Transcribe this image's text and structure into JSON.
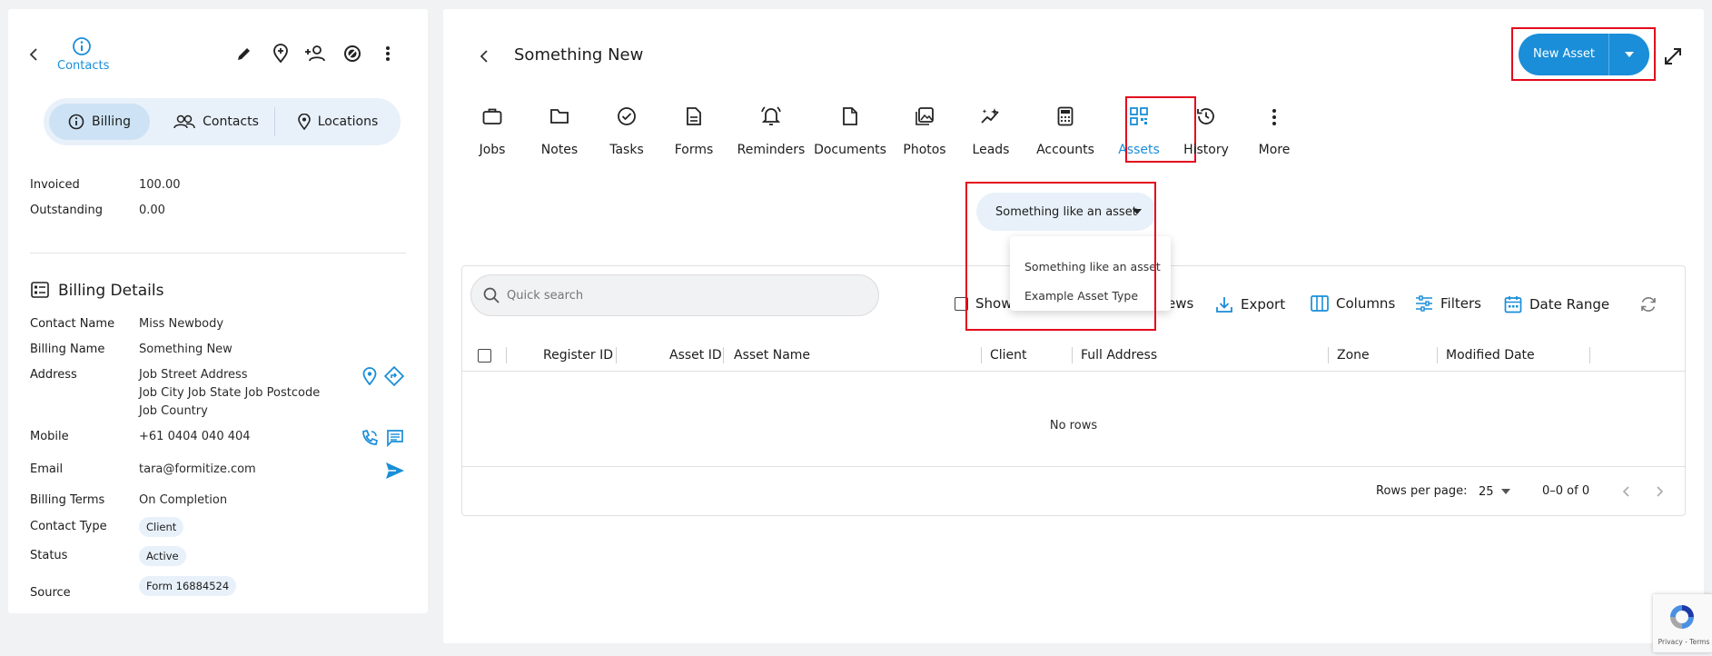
{
  "left": {
    "header": {
      "contacts_label": "Contacts"
    },
    "segments": [
      {
        "label": "Billing",
        "icon": "info-icon"
      },
      {
        "label": "Contacts",
        "icon": "people-icon"
      },
      {
        "label": "Locations",
        "icon": "pin-icon"
      }
    ],
    "totals": [
      {
        "label": "Invoiced",
        "value": "100.00"
      },
      {
        "label": "Outstanding",
        "value": "0.00"
      }
    ],
    "billing_details": {
      "title": "Billing Details",
      "contact_name_label": "Contact Name",
      "contact_name": "Miss Newbody",
      "billing_name_label": "Billing Name",
      "billing_name": "Something New",
      "address_label": "Address",
      "address_line1": "Job Street Address",
      "address_line2": "Job City Job State Job Postcode",
      "address_line3": "Job Country",
      "mobile_label": "Mobile",
      "mobile": "+61 0404 040 404",
      "email_label": "Email",
      "email": "tara@formitize.com",
      "billing_terms_label": "Billing Terms",
      "billing_terms": "On Completion",
      "contact_type_label": "Contact Type",
      "contact_type": "Client",
      "status_label": "Status",
      "status": "Active",
      "source_label": "Source",
      "source": "Form 16884524"
    }
  },
  "right": {
    "title": "Something New",
    "new_asset_label": "New Asset",
    "tabs": [
      {
        "label": "Jobs",
        "icon": "briefcase-icon"
      },
      {
        "label": "Notes",
        "icon": "folder-icon"
      },
      {
        "label": "Tasks",
        "icon": "check-circle-icon"
      },
      {
        "label": "Forms",
        "icon": "document-icon"
      },
      {
        "label": "Reminders",
        "icon": "bell-icon"
      },
      {
        "label": "Documents",
        "icon": "file-icon"
      },
      {
        "label": "Photos",
        "icon": "photo-icon"
      },
      {
        "label": "Leads",
        "icon": "sparkle-icon"
      },
      {
        "label": "Accounts",
        "icon": "calculator-icon"
      },
      {
        "label": "Assets",
        "icon": "qr-icon",
        "active": true
      },
      {
        "label": "History",
        "icon": "history-icon"
      },
      {
        "label": "More",
        "icon": "more-vertical-icon"
      }
    ],
    "asset_type": {
      "selected": "Something like an asset",
      "options": [
        "Something like an asset",
        "Example Asset Type"
      ]
    },
    "search": {
      "placeholder": "Quick search"
    },
    "toolbar": {
      "show_label": "Show",
      "views_label": "ews",
      "export_label": "Export",
      "columns_label": "Columns",
      "filters_label": "Filters",
      "date_range_label": "Date Range"
    },
    "columns": [
      "Register ID",
      "Asset ID",
      "Asset Name",
      "Client",
      "Full Address",
      "Zone",
      "Modified Date"
    ],
    "empty_text": "No rows",
    "pagination": {
      "rows_per_page_label": "Rows per page:",
      "rows_per_page": "25",
      "range": "0–0 of 0"
    }
  },
  "recaptcha": {
    "label": "Privacy - Terms"
  },
  "colors": {
    "accent": "#1a8ed8",
    "highlight": "#e3091c",
    "chip": "#e8f1fa"
  }
}
